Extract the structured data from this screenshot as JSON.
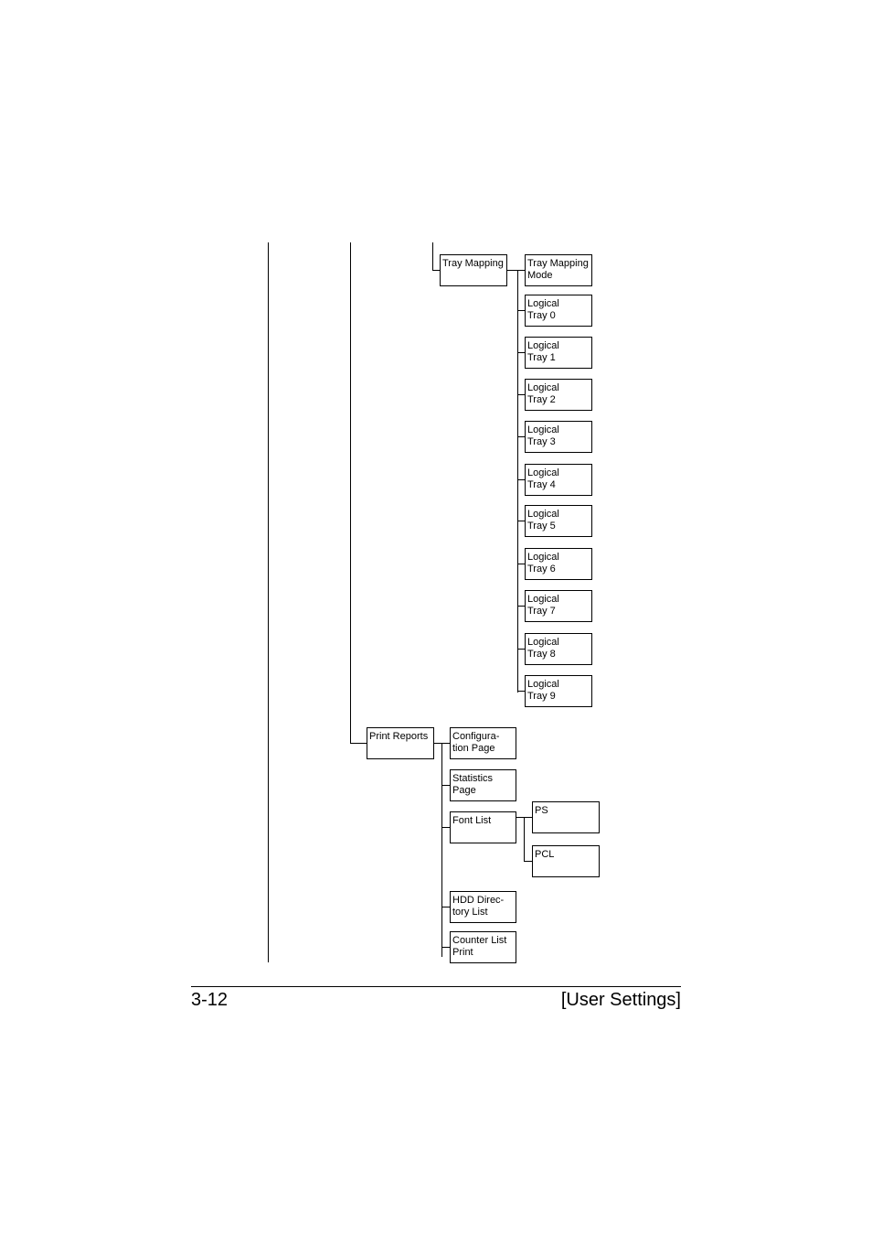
{
  "tree": {
    "tray_mapping": {
      "label": "Tray Mapping",
      "children": [
        "Tray Mapping\nMode",
        "Logical\nTray 0",
        "Logical\nTray 1",
        "Logical\nTray 2",
        "Logical\nTray 3",
        "Logical\nTray 4",
        "Logical\nTray 5",
        "Logical\nTray 6",
        "Logical\nTray 7",
        "Logical\nTray 8",
        "Logical\nTray 9"
      ]
    },
    "print_reports": {
      "label": "Print Reports",
      "children": [
        "Configura-\ntion Page",
        "Statistics\nPage",
        "Font List",
        "HDD Direc-\ntory List",
        "Counter List\nPrint"
      ],
      "font_list_children": [
        "PS",
        "PCL"
      ]
    }
  },
  "footer": {
    "page_number": "3-12",
    "section": "[User Settings]"
  }
}
